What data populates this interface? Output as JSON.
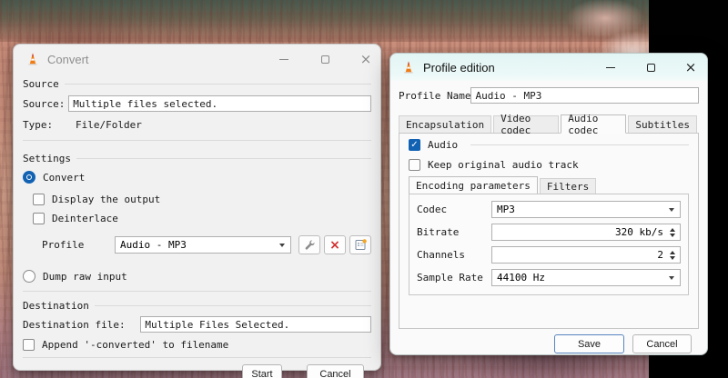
{
  "colors": {
    "accent_blue": "#1262b3",
    "danger_red": "#d22d2d",
    "profile_titlebar": "#e2f5f4",
    "letterbox": "#010101"
  },
  "icons": {
    "close_glyph": "×",
    "delete_glyph": "×",
    "check_glyph": "✓"
  },
  "convert_window": {
    "title": "Convert",
    "source_group": {
      "title": "Source",
      "source_label": "Source:",
      "source_value": "Multiple files selected.",
      "type_label": "Type:",
      "type_value": "File/Folder"
    },
    "settings_group": {
      "title": "Settings",
      "convert_radio_label": "Convert",
      "display_output_label": "Display the output",
      "deinterlace_label": "Deinterlace",
      "profile_label": "Profile",
      "profile_value": "Audio - MP3",
      "dump_radio_label": "Dump raw input"
    },
    "destination_group": {
      "title": "Destination",
      "destination_file_label": "Destination file:",
      "destination_file_value": "Multiple Files Selected.",
      "append_label": "Append '-converted' to filename"
    },
    "start_button": "Start",
    "cancel_button": "Cancel"
  },
  "profile_window": {
    "title": "Profile edition",
    "profile_name_label": "Profile Name",
    "profile_name_value": "Audio - MP3",
    "tabs": [
      "Encapsulation",
      "Video codec",
      "Audio codec",
      "Subtitles"
    ],
    "active_tab": "Audio codec",
    "audio_codec_tab": {
      "audio_checkbox_label": "Audio",
      "keep_original_label": "Keep original audio track",
      "subtabs": [
        "Encoding parameters",
        "Filters"
      ],
      "active_subtab": "Encoding parameters",
      "rows": [
        {
          "label": "Codec",
          "value": "MP3",
          "control": "combobox"
        },
        {
          "label": "Bitrate",
          "value": "320 kb/s",
          "control": "spinbox"
        },
        {
          "label": "Channels",
          "value": "2",
          "control": "spinbox"
        },
        {
          "label": "Sample Rate",
          "value": "44100 Hz",
          "control": "combobox"
        }
      ]
    },
    "save_button": "Save",
    "cancel_button": "Cancel"
  }
}
